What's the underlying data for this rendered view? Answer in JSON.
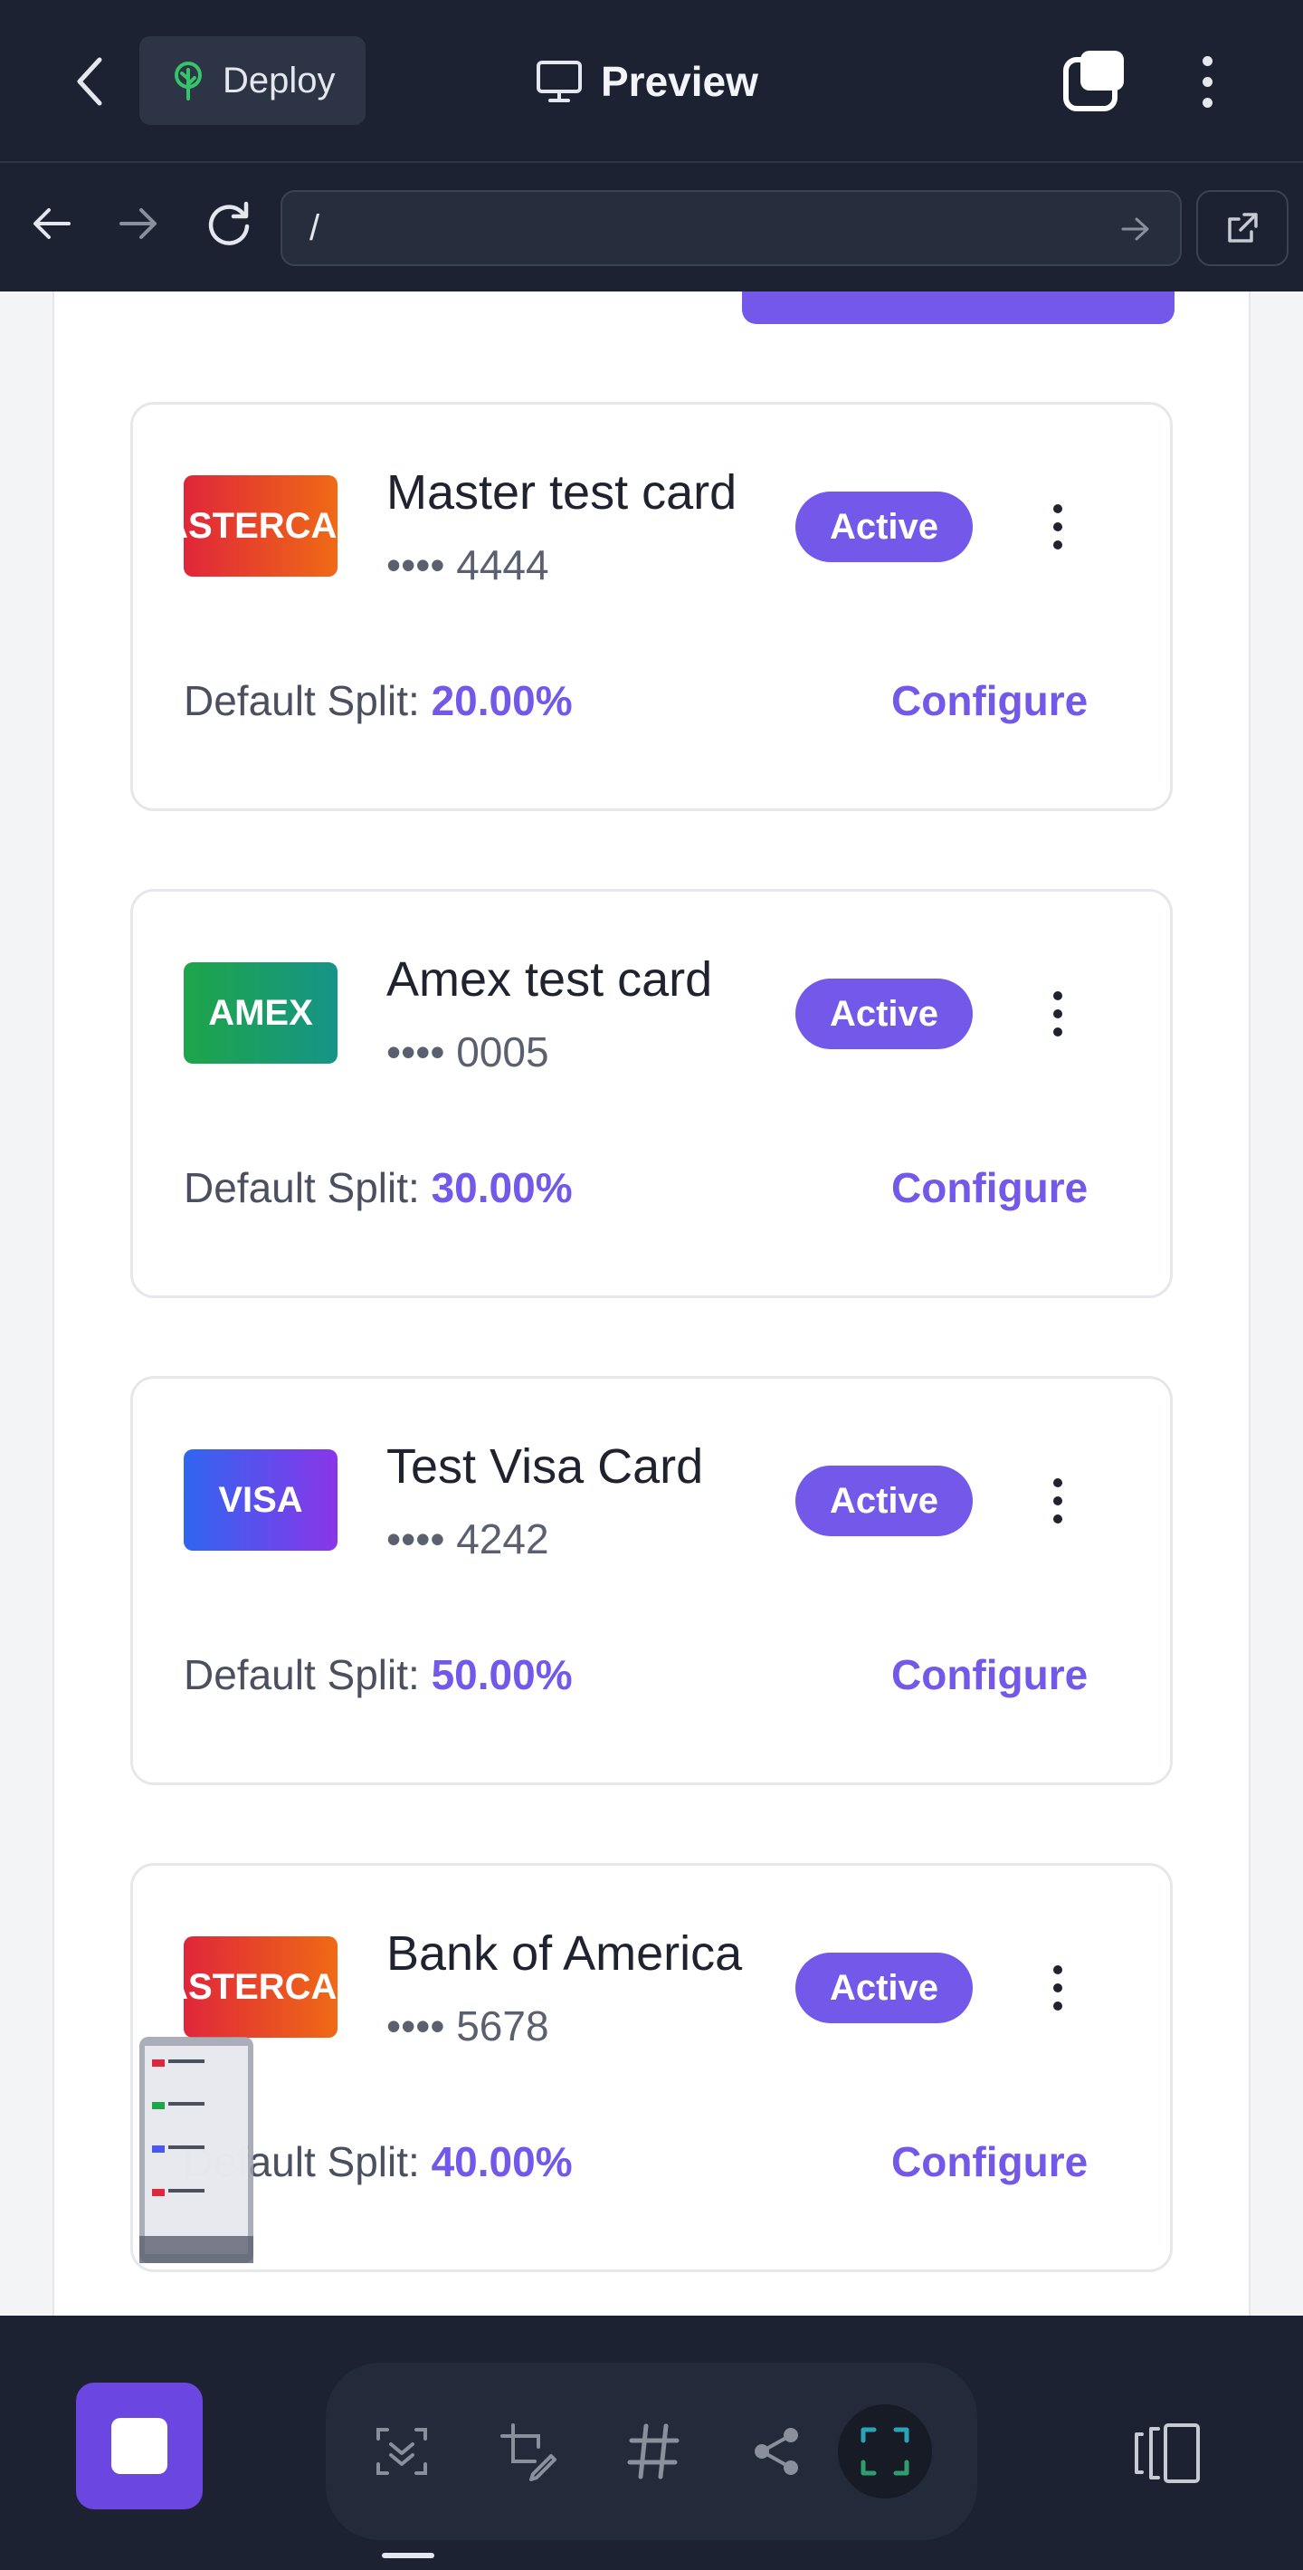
{
  "topbar": {
    "deploy_label": "Deploy",
    "preview_label": "Preview"
  },
  "browser": {
    "url": "/"
  },
  "cards": [
    {
      "logo_text": "MASTERCARD",
      "logo_type": "mastercard",
      "name": "Master test card",
      "number": "•••• 4444",
      "status": "Active",
      "split_label": "Default Split:",
      "split_value": "20.00%",
      "configure": "Configure"
    },
    {
      "logo_text": "AMEX",
      "logo_type": "amex",
      "name": "Amex test card",
      "number": "•••• 0005",
      "status": "Active",
      "split_label": "Default Split:",
      "split_value": "30.00%",
      "configure": "Configure"
    },
    {
      "logo_text": "VISA",
      "logo_type": "visa",
      "name": "Test Visa Card",
      "number": "•••• 4242",
      "status": "Active",
      "split_label": "Default Split:",
      "split_value": "50.00%",
      "configure": "Configure"
    },
    {
      "logo_text": "MASTERCARD",
      "logo_type": "mastercard",
      "name": "Bank of America",
      "number": "•••• 5678",
      "status": "Active",
      "split_label": "Default Split:",
      "split_value": "40.00%",
      "configure": "Configure"
    }
  ],
  "icons": {
    "back": "chevron-left-icon",
    "deploy": "tree-icon",
    "preview": "monitor-icon",
    "tabs": "tabs-icon",
    "more": "more-vertical-icon",
    "nav_back": "arrow-left-icon",
    "nav_forward": "arrow-right-icon",
    "reload": "reload-icon",
    "go": "arrow-right-icon",
    "external": "external-link-icon"
  },
  "colors": {
    "accent": "#7358ea",
    "dark": "#1c2231"
  }
}
